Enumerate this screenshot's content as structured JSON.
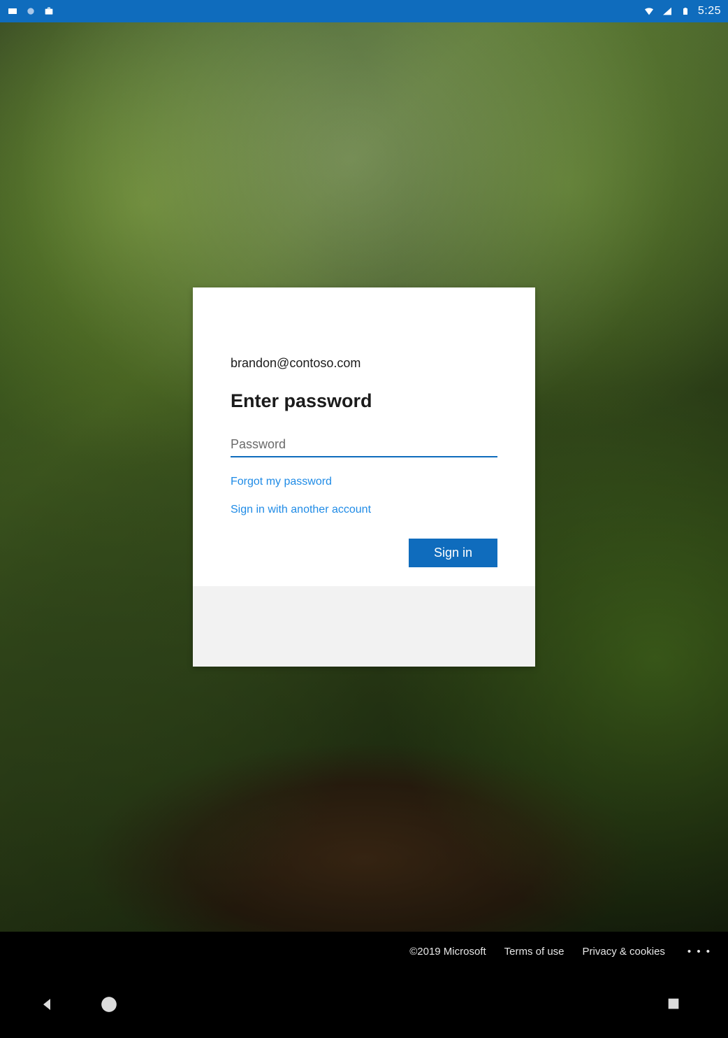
{
  "status_bar": {
    "time": "5:25"
  },
  "login": {
    "email": "brandon@contoso.com",
    "title": "Enter password",
    "password_placeholder": "Password",
    "password_value": "",
    "forgot_link": "Forgot my password",
    "another_account_link": "Sign in with another account",
    "signin_button": "Sign in"
  },
  "footer": {
    "copyright": "©2019 Microsoft",
    "terms": "Terms of use",
    "privacy": "Privacy & cookies",
    "more": "• • •"
  },
  "colors": {
    "accent": "#0f6cbd",
    "link": "#1f8be6"
  }
}
